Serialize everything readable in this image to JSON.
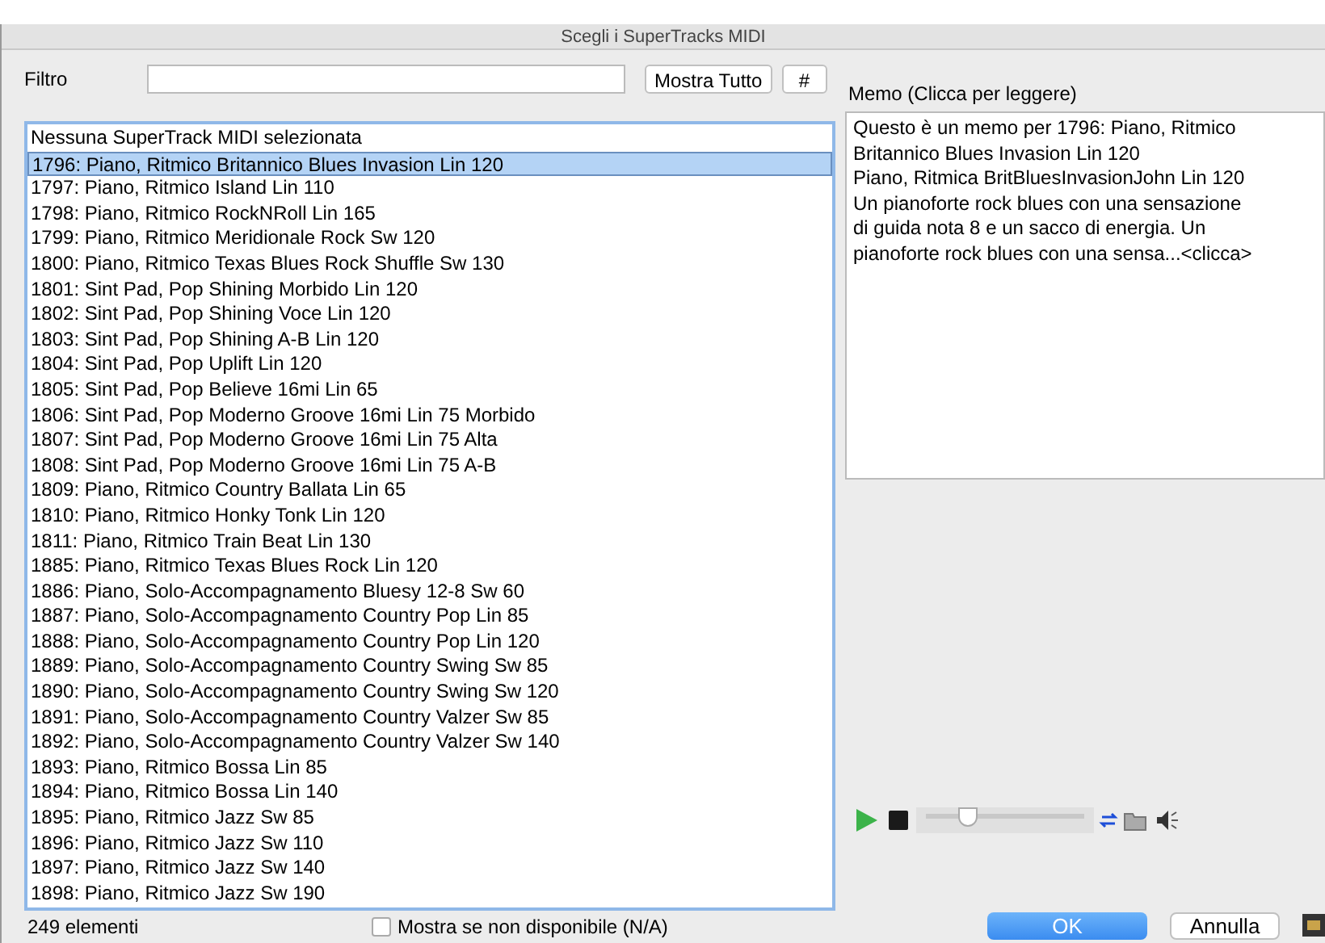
{
  "window": {
    "title": "Scegli i SuperTracks MIDI"
  },
  "filter": {
    "label": "Filtro"
  },
  "buttons": {
    "show_all": "Mostra Tutto",
    "number": "#",
    "ok": "OK",
    "cancel": "Annulla"
  },
  "list": {
    "items": [
      {
        "text": "Nessuna SuperTrack MIDI selezionata",
        "selected": false
      },
      {
        "text": "1796: Piano, Ritmico Britannico Blues Invasion Lin 120",
        "selected": true
      },
      {
        "text": "1797: Piano, Ritmico Island Lin 110",
        "selected": false
      },
      {
        "text": "1798: Piano, Ritmico RockNRoll Lin 165",
        "selected": false
      },
      {
        "text": "1799: Piano, Ritmico Meridionale Rock Sw 120",
        "selected": false
      },
      {
        "text": "1800: Piano, Ritmico Texas Blues Rock Shuffle Sw 130",
        "selected": false
      },
      {
        "text": "1801: Sint Pad, Pop Shining Morbido Lin 120",
        "selected": false
      },
      {
        "text": "1802: Sint Pad, Pop Shining Voce Lin 120",
        "selected": false
      },
      {
        "text": "1803: Sint Pad, Pop Shining A-B Lin 120",
        "selected": false
      },
      {
        "text": "1804: Sint Pad, Pop Uplift Lin 120",
        "selected": false
      },
      {
        "text": "1805: Sint Pad, Pop Believe 16mi Lin 65",
        "selected": false
      },
      {
        "text": "1806: Sint Pad, Pop Moderno Groove 16mi Lin 75 Morbido",
        "selected": false
      },
      {
        "text": "1807: Sint Pad, Pop Moderno Groove 16mi Lin 75 Alta",
        "selected": false
      },
      {
        "text": "1808: Sint Pad, Pop Moderno Groove 16mi Lin 75 A-B",
        "selected": false
      },
      {
        "text": "1809: Piano, Ritmico Country Ballata Lin 65",
        "selected": false
      },
      {
        "text": "1810: Piano, Ritmico Honky Tonk Lin 120",
        "selected": false
      },
      {
        "text": "1811: Piano, Ritmico Train Beat Lin 130",
        "selected": false
      },
      {
        "text": "1885: Piano, Ritmico Texas Blues Rock Lin 120",
        "selected": false
      },
      {
        "text": "1886: Piano, Solo-Accompagnamento Bluesy 12-8 Sw 60",
        "selected": false
      },
      {
        "text": "1887: Piano, Solo-Accompagnamento Country Pop Lin 85",
        "selected": false
      },
      {
        "text": "1888: Piano, Solo-Accompagnamento Country Pop Lin 120",
        "selected": false
      },
      {
        "text": "1889: Piano, Solo-Accompagnamento Country Swing Sw 85",
        "selected": false
      },
      {
        "text": "1890: Piano, Solo-Accompagnamento Country Swing Sw 120",
        "selected": false
      },
      {
        "text": "1891: Piano, Solo-Accompagnamento Country Valzer Sw 85",
        "selected": false
      },
      {
        "text": "1892: Piano, Solo-Accompagnamento Country Valzer Sw 140",
        "selected": false
      },
      {
        "text": "1893: Piano, Ritmico Bossa Lin 85",
        "selected": false
      },
      {
        "text": "1894: Piano, Ritmico Bossa Lin 140",
        "selected": false
      },
      {
        "text": "1895: Piano, Ritmico Jazz Sw 85",
        "selected": false
      },
      {
        "text": "1896: Piano, Ritmico Jazz Sw 110",
        "selected": false
      },
      {
        "text": "1897: Piano, Ritmico Jazz Sw 140",
        "selected": false
      },
      {
        "text": "1898: Piano, Ritmico Jazz Sw 190",
        "selected": false
      }
    ],
    "count": "249 elementi"
  },
  "memo": {
    "label": "Memo (Clicca per leggere)",
    "lines": [
      "Questo è un memo per 1796: Piano, Ritmico",
      "Britannico Blues Invasion Lin 120",
      "Piano, Ritmica BritBluesInvasionJohn Lin 120",
      "Un pianoforte rock blues con una sensazione",
      "di guida nota 8 e un sacco di energia.  Un",
      "pianoforte rock blues con una sensa...<clicca>"
    ]
  },
  "player": {
    "level": 0.27
  },
  "show_unavailable": {
    "label": "Mostra se non disponibile (N/A)",
    "checked": false
  }
}
